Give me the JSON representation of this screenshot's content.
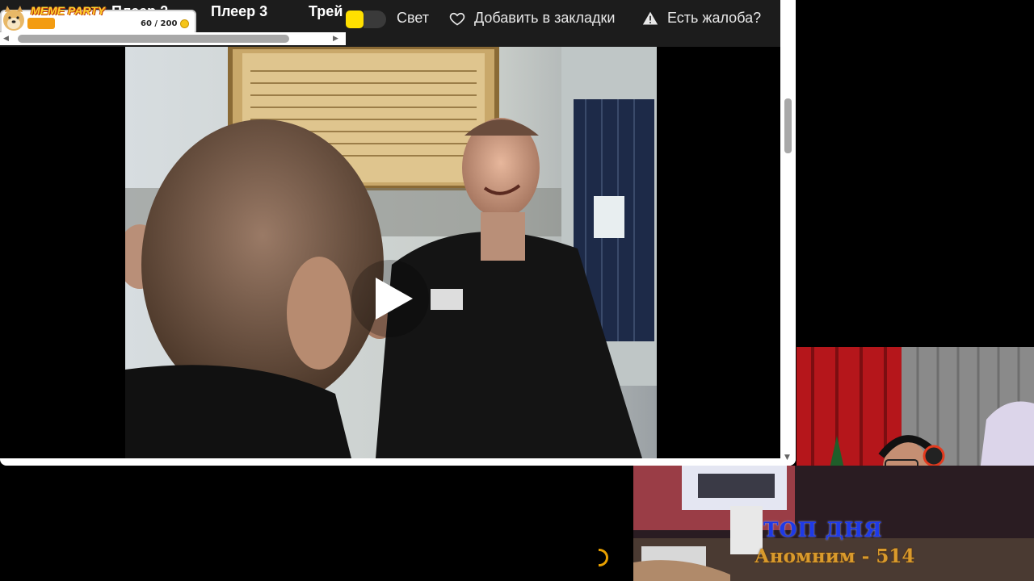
{
  "header": {
    "tabs": [
      {
        "label": "Плеер 2"
      },
      {
        "label": "Плеер 3"
      },
      {
        "label": "Трей"
      }
    ],
    "light_label": "Свет",
    "bookmark_label": "Добавить в закладки",
    "complaint_label": "Есть жалоба?"
  },
  "widget": {
    "title": "MEME PARTY",
    "count": "60 / 200",
    "progress": 0.3
  },
  "stream": {
    "top_title": "ТОП ДНЯ",
    "top_user": "Аномним - 514"
  },
  "colors": {
    "topbar": "#1c1c1c",
    "light_toggle": "#ffe000",
    "top_title": "#1e3ae8",
    "top_user": "#d99a2c"
  }
}
